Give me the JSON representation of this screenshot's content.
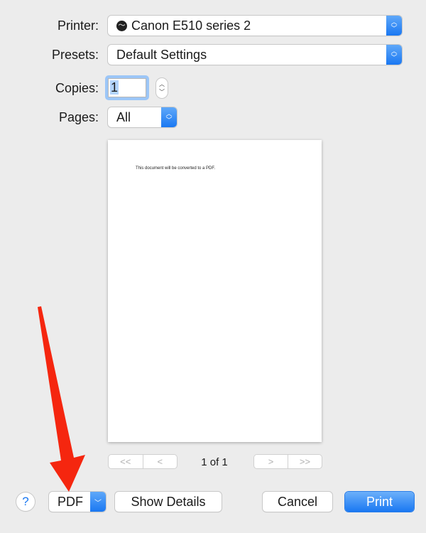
{
  "printer": {
    "label": "Printer:",
    "value": "Canon E510 series 2",
    "icon": "printer-status-icon"
  },
  "presets": {
    "label": "Presets:",
    "value": "Default Settings"
  },
  "copies": {
    "label": "Copies:",
    "value": "1"
  },
  "pages": {
    "label": "Pages:",
    "value": "All"
  },
  "preview": {
    "text": "This document will be converted to a PDF.",
    "page_indicator": "1 of 1",
    "first": "<<",
    "prev": "<",
    "next": ">",
    "last": ">>"
  },
  "footer": {
    "help": "?",
    "pdf": "PDF",
    "show_details": "Show Details",
    "cancel": "Cancel",
    "print": "Print"
  },
  "colors": {
    "accent": "#1a78f2",
    "annotation_arrow": "#f5260f"
  }
}
